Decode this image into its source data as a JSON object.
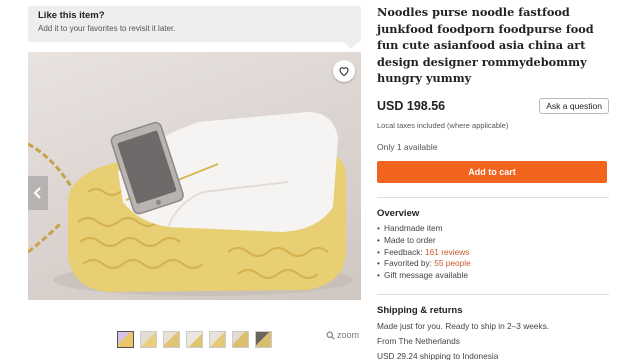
{
  "favorite_prompt": {
    "title": "Like this item?",
    "subtitle": "Add it to your favorites to revisit it later."
  },
  "gallery": {
    "thumbnail_count": 7,
    "zoom_label": "zoom"
  },
  "product": {
    "title": "Noodles purse noodle fastfood junkfood foodporn foodpurse food fun cute asianfood asia china art design designer rommydebommy hungry yummy",
    "price": "USD 198.56",
    "ask_question_label": "Ask a question",
    "tax_note": "Local taxes included (where applicable)",
    "stock_note": "Only 1 available",
    "add_to_cart_label": "Add to cart"
  },
  "overview": {
    "heading": "Overview",
    "items": {
      "handmade": "Handmade item",
      "made_to_order": "Made to order",
      "feedback_label": "Feedback: ",
      "feedback_link": "161 reviews",
      "favorited_label": "Favorited by: ",
      "favorited_link": "55 people",
      "gift": "Gift message available"
    }
  },
  "shipping": {
    "heading": "Shipping & returns",
    "ready_text": "Made just for you. Ready to ship in 2–3 weeks.",
    "from_text": "From The Netherlands",
    "cost_prefix": "USD 29.24 shipping to ",
    "destination": "Indonesia"
  },
  "colors": {
    "accent": "#f1641e",
    "link": "#c75a2a"
  }
}
